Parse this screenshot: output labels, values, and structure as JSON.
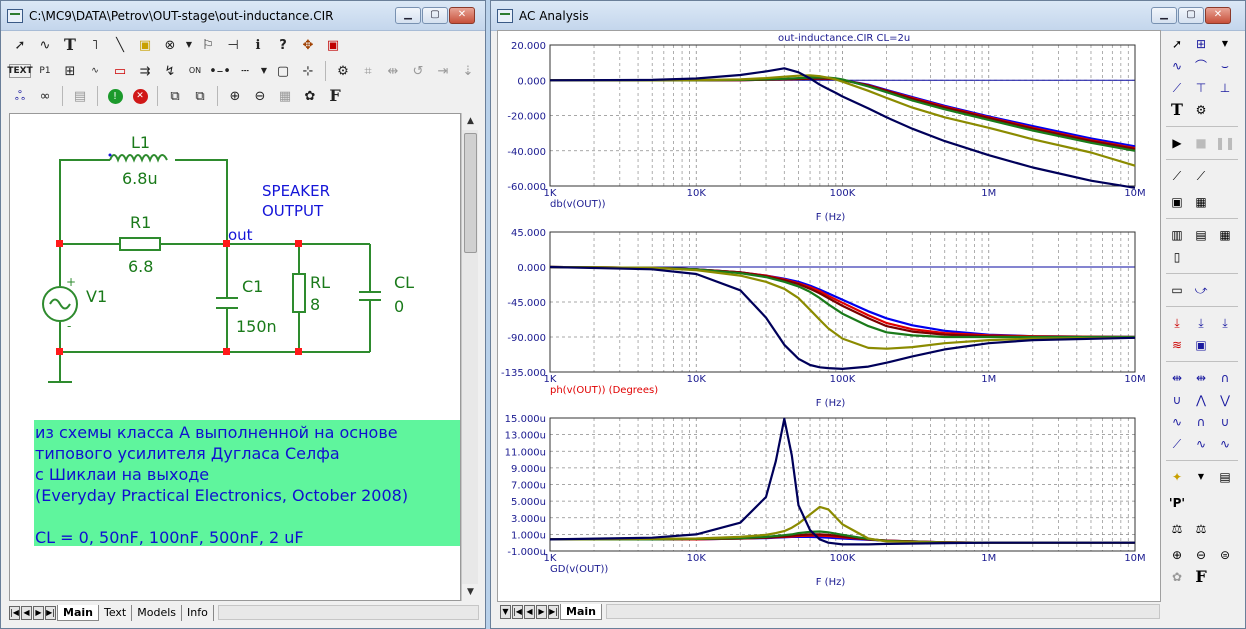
{
  "schematic_window": {
    "title": "C:\\MC9\\DATA\\Petrov\\OUT-stage\\out-inductance.CIR",
    "toolbar_row1": [
      "arrow-tool",
      "wire-tool",
      "text-tool",
      "ortho-wire",
      "diagonal-line",
      "component",
      "rotate",
      "flag",
      "info",
      "help",
      "pin",
      "probe"
    ],
    "toolbar_row2_labels": [
      "TEXT",
      "P1",
      "ON"
    ],
    "tabs": [
      "Main",
      "Text",
      "Models",
      "Info"
    ],
    "active_tab": "Main"
  },
  "schematic": {
    "components": {
      "L1": {
        "name": "L1",
        "value": "6.8u"
      },
      "R1": {
        "name": "R1",
        "value": "6.8"
      },
      "C1": {
        "name": "C1",
        "value": "150n"
      },
      "RL": {
        "name": "RL",
        "value": "8"
      },
      "CL": {
        "name": "CL",
        "value": "0"
      },
      "V1": {
        "name": "V1"
      }
    },
    "node_label": "out",
    "speaker_label": "SPEAKER\nOUTPUT",
    "note": "из схемы класса А выполненной на основе\nтипового усилителя Дугласа Селфа\nс Шиклаи на выходе\n(Everyday Practical Electronics, October 2008)\n\nCL = 0, 50nF, 100nF, 500nF, 2 uF",
    "colors": {
      "wire": "#2e8b2e",
      "label": "#1a7a1a",
      "blue_text": "#1515d8",
      "node": "#ff0000",
      "note_bg": "#5ff59d"
    }
  },
  "analysis_window": {
    "title": "AC Analysis",
    "tabs": [
      "Main"
    ],
    "active_tab": "Main"
  },
  "chart_data": [
    {
      "type": "line",
      "title": "out-inductance.CIR CL=2u",
      "ylabel": "db(v(OUT))",
      "xlabel": "F (Hz)",
      "x_scale": "log",
      "x_ticks": [
        "1K",
        "10K",
        "100K",
        "1M",
        "10M"
      ],
      "y_ticks": [
        "20.000",
        "0.000",
        "-20.000",
        "-40.000",
        "-60.000"
      ],
      "xlim": [
        1000,
        10000000
      ],
      "ylim": [
        -60,
        20
      ],
      "x": [
        1000,
        5000,
        10000,
        20000,
        30000,
        40000,
        50000,
        60000,
        70000,
        80000,
        90000,
        100000,
        150000,
        200000,
        300000,
        500000,
        1000000,
        2000000,
        5000000,
        10000000
      ],
      "series": [
        {
          "color": "#0000ee",
          "values": [
            0,
            0,
            0,
            0.1,
            0.3,
            0.5,
            0.7,
            0.9,
            1.0,
            0.9,
            0.6,
            0.2,
            -2.5,
            -5.5,
            -9.5,
            -14.5,
            -20.5,
            -26,
            -33,
            -37.5
          ]
        },
        {
          "color": "#e00000",
          "values": [
            0,
            0,
            0,
            0.1,
            0.3,
            0.5,
            0.7,
            0.9,
            1.0,
            0.9,
            0.6,
            0.2,
            -2.8,
            -5.8,
            -10,
            -15,
            -21,
            -27,
            -34,
            -38.5
          ]
        },
        {
          "color": "#7a0000",
          "values": [
            0,
            0,
            0,
            0.1,
            0.3,
            0.5,
            0.7,
            0.9,
            1.0,
            0.9,
            0.6,
            0.1,
            -3,
            -6,
            -10.5,
            -15.5,
            -21.5,
            -27.5,
            -34.5,
            -39
          ]
        },
        {
          "color": "#1a7a1a",
          "values": [
            0,
            0,
            0,
            0.2,
            0.5,
            0.8,
            1.2,
            1.5,
            1.6,
            1.5,
            1.1,
            0.5,
            -3.5,
            -6.8,
            -11.5,
            -16.5,
            -22.5,
            -28.5,
            -35.5,
            -40
          ]
        },
        {
          "color": "#8b8b00",
          "values": [
            0,
            0,
            0.1,
            0.5,
            1.2,
            2.0,
            2.6,
            2.8,
            2.3,
            1.4,
            0.4,
            -0.8,
            -6,
            -10,
            -15.5,
            -21,
            -27,
            -33.5,
            -41,
            -48.5
          ]
        },
        {
          "color": "#00005a",
          "values": [
            0,
            0.2,
            1.0,
            3.0,
            5.0,
            6.8,
            4.5,
            1.0,
            -2.5,
            -5.0,
            -7.2,
            -9.2,
            -16,
            -21,
            -27.5,
            -34.5,
            -42.5,
            -49.5,
            -57,
            -61
          ]
        }
      ]
    },
    {
      "type": "line",
      "ylabel": "ph(v(OUT)) (Degrees)",
      "xlabel": "F (Hz)",
      "x_scale": "log",
      "x_ticks": [
        "1K",
        "10K",
        "100K",
        "1M",
        "10M"
      ],
      "y_ticks": [
        "45.000",
        "0.000",
        "-45.000",
        "-90.000",
        "-135.000"
      ],
      "xlim": [
        1000,
        10000000
      ],
      "ylim": [
        -135,
        45
      ],
      "x": [
        1000,
        5000,
        10000,
        20000,
        30000,
        40000,
        50000,
        60000,
        70000,
        80000,
        100000,
        150000,
        200000,
        300000,
        500000,
        1000000,
        2000000,
        10000000
      ],
      "series": [
        {
          "color": "#0000ee",
          "values": [
            0,
            -1,
            -3,
            -7,
            -11,
            -15,
            -19,
            -24,
            -29,
            -34,
            -42,
            -57,
            -66,
            -75,
            -82,
            -87,
            -89,
            -90
          ]
        },
        {
          "color": "#e00000",
          "values": [
            0,
            -1,
            -3,
            -7,
            -11,
            -16,
            -21,
            -26,
            -31,
            -37,
            -46,
            -62,
            -72,
            -80,
            -85,
            -88,
            -89,
            -90
          ]
        },
        {
          "color": "#7a0000",
          "values": [
            0,
            -1,
            -3,
            -7,
            -12,
            -17,
            -22,
            -28,
            -34,
            -40,
            -50,
            -66,
            -76,
            -83,
            -87,
            -89,
            -90,
            -90
          ]
        },
        {
          "color": "#1a7a1a",
          "values": [
            0,
            -1,
            -3,
            -8,
            -13,
            -19,
            -25,
            -32,
            -40,
            -48,
            -60,
            -76,
            -84,
            -88,
            -90,
            -90,
            -90,
            -90
          ]
        },
        {
          "color": "#8b8b00",
          "values": [
            0,
            -1,
            -4,
            -11,
            -19,
            -28,
            -40,
            -55,
            -68,
            -79,
            -92,
            -104,
            -105,
            -103,
            -98,
            -94,
            -92,
            -91
          ]
        },
        {
          "color": "#00005a",
          "values": [
            0,
            -3,
            -9,
            -30,
            -65,
            -100,
            -118,
            -126,
            -129,
            -130,
            -131,
            -128,
            -123,
            -115,
            -106,
            -98,
            -94,
            -91
          ]
        }
      ]
    },
    {
      "type": "line",
      "ylabel": "GD(v(OUT))",
      "xlabel": "F (Hz)",
      "x_scale": "log",
      "x_ticks": [
        "1K",
        "10K",
        "100K",
        "1M",
        "10M"
      ],
      "y_ticks": [
        "15.000u",
        "13.000u",
        "11.000u",
        "9.000u",
        "7.000u",
        "5.000u",
        "3.000u",
        "1.000u",
        "-1.000u"
      ],
      "xlim": [
        1000,
        10000000
      ],
      "ylim": [
        -1,
        15
      ],
      "x": [
        1000,
        5000,
        10000,
        20000,
        30000,
        35000,
        40000,
        45000,
        50000,
        60000,
        70000,
        80000,
        100000,
        150000,
        200000,
        500000,
        1000000,
        10000000
      ],
      "series": [
        {
          "color": "#0000ee",
          "values": [
            0.4,
            0.4,
            0.4,
            0.5,
            0.55,
            0.6,
            0.65,
            0.7,
            0.7,
            0.7,
            0.65,
            0.6,
            0.5,
            0.35,
            0.25,
            0.05,
            0,
            0
          ]
        },
        {
          "color": "#e00000",
          "values": [
            0.4,
            0.4,
            0.4,
            0.5,
            0.6,
            0.65,
            0.7,
            0.75,
            0.8,
            0.85,
            0.85,
            0.8,
            0.65,
            0.4,
            0.25,
            0.05,
            0,
            0
          ]
        },
        {
          "color": "#7a0000",
          "values": [
            0.4,
            0.4,
            0.45,
            0.5,
            0.6,
            0.7,
            0.75,
            0.85,
            0.9,
            1.0,
            1.0,
            0.95,
            0.75,
            0.4,
            0.25,
            0.05,
            0,
            0
          ]
        },
        {
          "color": "#1a7a1a",
          "values": [
            0.4,
            0.4,
            0.45,
            0.55,
            0.7,
            0.8,
            0.9,
            1.0,
            1.15,
            1.3,
            1.35,
            1.25,
            0.95,
            0.45,
            0.2,
            0.02,
            0,
            0
          ]
        },
        {
          "color": "#8b8b00",
          "values": [
            0.4,
            0.45,
            0.5,
            0.7,
            0.95,
            1.15,
            1.4,
            1.8,
            2.3,
            3.4,
            4.3,
            4.0,
            2.2,
            0.5,
            0.15,
            0,
            0,
            0
          ]
        },
        {
          "color": "#00005a",
          "values": [
            0.4,
            0.6,
            1.0,
            2.4,
            5.5,
            9.8,
            14.9,
            10.5,
            4.5,
            1.5,
            0.4,
            0.0,
            -0.2,
            -0.2,
            -0.15,
            -0.05,
            0,
            0
          ]
        }
      ]
    }
  ]
}
